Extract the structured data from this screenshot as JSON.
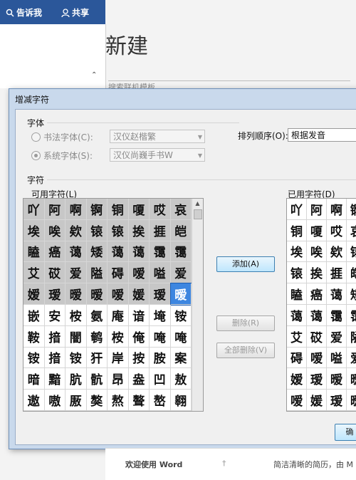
{
  "ribbon": {
    "tell_me": "告诉我",
    "share": "共享"
  },
  "backstage": {
    "title": "新建",
    "search_placeholder": "搜索联机模板",
    "welcome": "欢迎使用 Word",
    "resume": "简洁清晰的简历，由 M"
  },
  "dialog": {
    "title": "增减字符",
    "font_group": "字体",
    "calligraphy_font_label": "书法字体(C):",
    "calligraphy_font_value": "汉仪赵楷繁",
    "system_font_label": "系统字体(S):",
    "system_font_value": "汉仪尚巍手书W",
    "sort_label": "排列顺序(O):",
    "sort_value": "根据发音",
    "chars_group": "字符",
    "available_label": "可用字符(L)",
    "used_label": "已用字符(D)",
    "add_button": "添加(A)",
    "remove_button": "删除(R)",
    "remove_all_button": "全部删除(V)",
    "ok_button": "确"
  },
  "available_chars": [
    "吖",
    "阿",
    "啊",
    "锕",
    "铜",
    "嗄",
    "哎",
    "哀",
    "埃",
    "唉",
    "欸",
    "锿",
    "锿",
    "挨",
    "捱",
    "皑",
    "瞌",
    "癌",
    "蔼",
    "矮",
    "蔼",
    "蔼",
    "霭",
    "霭",
    "艾",
    "砹",
    "爱",
    "隘",
    "碍",
    "嗳",
    "嗌",
    "爱",
    "嫒",
    "瑷",
    "暧",
    "暧",
    "嗳",
    "媛",
    "瑷",
    "暧",
    "嵌",
    "安",
    "桉",
    "氨",
    "庵",
    "谙",
    "埯",
    "铵",
    "鞍",
    "揞",
    "闇",
    "鹌",
    "桉",
    "俺",
    "唵",
    "唵",
    "铵",
    "揞",
    "铵",
    "犴",
    "岸",
    "按",
    "胺",
    "案",
    "暗",
    "黯",
    "肮",
    "骯",
    "昂",
    "盎",
    "凹",
    "敖",
    "遨",
    "嗷",
    "厫",
    "獒",
    "熬",
    "聱",
    "嶅",
    "翱"
  ],
  "used_chars": [
    "吖",
    "阿",
    "啊",
    "锕",
    "铜",
    "嗄",
    "哎",
    "哀",
    "埃",
    "唉",
    "欸",
    "锿",
    "锿",
    "挨",
    "捱",
    "皑",
    "瞌",
    "癌",
    "蔼",
    "矮",
    "蔼",
    "蔼",
    "霭",
    "霭",
    "艾",
    "砹",
    "爱",
    "隘",
    "碍",
    "嗳",
    "嗌",
    "爱",
    "嫒",
    "瑷",
    "暧",
    "暧",
    "嗳",
    "媛",
    "瑷",
    "暧"
  ],
  "colors": {
    "ribbon_blue": "#2b579a",
    "selected_cell": "#3d86e0",
    "used_cell": "#c7c7c7"
  }
}
